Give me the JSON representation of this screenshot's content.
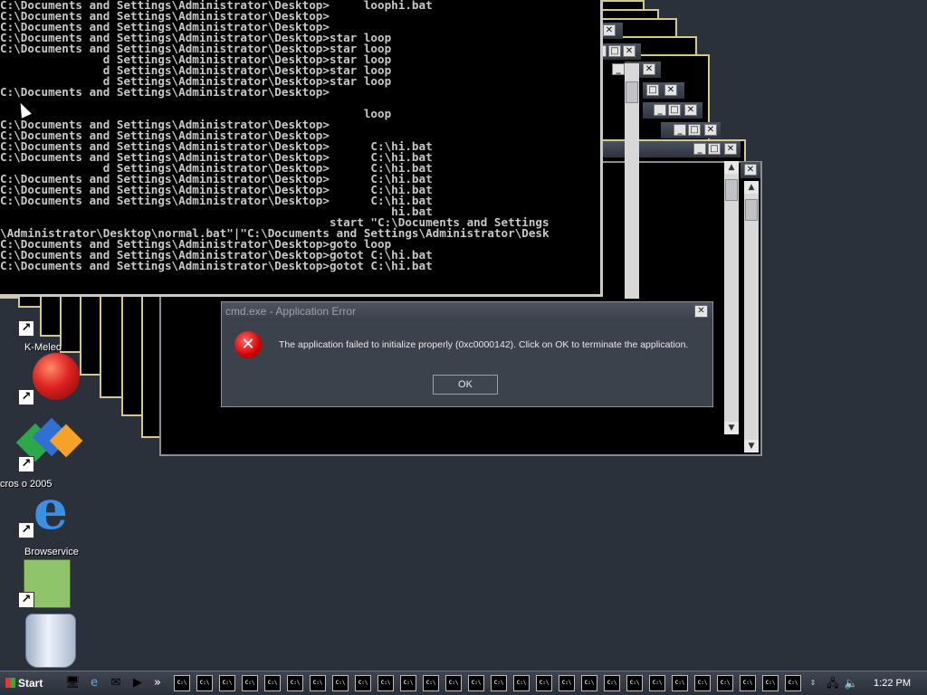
{
  "console": {
    "lines": [
      "C:\\Documents and Settings\\Administrator\\Desktop>     loophi.bat",
      "C:\\Documents and Settings\\Administrator\\Desktop>",
      "C:\\Documents and Settings\\Administrator\\Desktop>",
      "C:\\Documents and Settings\\Administrator\\Desktop>star loop",
      "C:\\Documents and Settings\\Administrator\\Desktop>star loop",
      "               d Settings\\Administrator\\Desktop>star loop",
      "               d Settings\\Administrator\\Desktop>star loop",
      "               d Settings\\Administrator\\Desktop>star loop",
      "C:\\Documents and Settings\\Administrator\\Desktop>",
      "",
      "                                                     loop",
      "C:\\Documents and Settings\\Administrator\\Desktop>",
      "C:\\Documents and Settings\\Administrator\\Desktop>",
      "C:\\Documents and Settings\\Administrator\\Desktop>      C:\\hi.bat",
      "C:\\Documents and Settings\\Administrator\\Desktop>      C:\\hi.bat",
      "               d Settings\\Administrator\\Desktop>      C:\\hi.bat",
      "C:\\Documents and Settings\\Administrator\\Desktop>      C:\\hi.bat",
      "C:\\Documents and Settings\\Administrator\\Desktop>      C:\\hi.bat",
      "C:\\Documents and Settings\\Administrator\\Desktop>      C:\\hi.bat",
      "                                                         hi.bat",
      "                                                start \"C:\\Documents and Settings",
      "\\Administrator\\Desktop\\normal.bat\"|\"C:\\Documents and Settings\\Administrator\\Desk",
      "C:\\Documents and Settings\\Administrator\\Desktop>goto loop",
      "C:\\Documents and Settings\\Administrator\\Desktop>gotot C:\\hi.bat",
      "C:\\Documents and Settings\\Administrator\\Desktop>gotot C:\\hi.bat"
    ]
  },
  "desktop_icons": [
    {
      "label": "K-Meleo",
      "icon": "k-meleo-icon"
    },
    {
      "label": "",
      "icon": "red-ball-icon"
    },
    {
      "label": "cros              o 2005",
      "icon": "visual-studio-icon"
    },
    {
      "label": "Browservice",
      "icon": "internet-explorer-icon"
    },
    {
      "label": "",
      "icon": "frog-notepad-icon"
    },
    {
      "label": "",
      "icon": "recycle-bin-icon"
    }
  ],
  "dialog": {
    "title": "cmd.exe - Application Error",
    "message": "The application failed to initialize properly (0xc0000142). Click on OK to terminate the application.",
    "ok_label": "OK",
    "close_glyph": "✕",
    "icon_glyph": "✕"
  },
  "window_buttons": {
    "minimize": "_",
    "maximize": "□",
    "close": "✕"
  },
  "taskbar": {
    "start_label": "Start",
    "quicklaunch_more": "»",
    "task_glyph": "C:\\",
    "task_count": 28,
    "clock": "1:22 PM"
  }
}
